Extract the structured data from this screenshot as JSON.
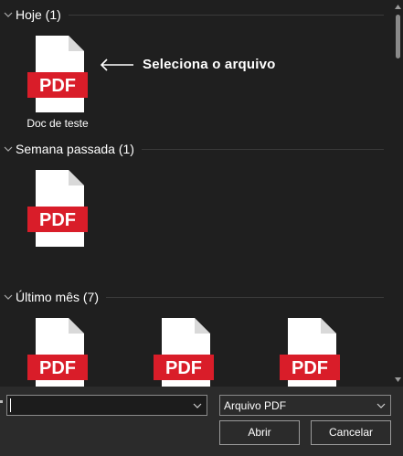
{
  "groups": [
    {
      "label": "Hoje (1)"
    },
    {
      "label": "Semana passada (1)"
    },
    {
      "label": "Último mês (7)"
    }
  ],
  "files": {
    "today": {
      "name": "Doc de teste",
      "badge": "PDF"
    },
    "last_week": {
      "badge": "PDF"
    },
    "last_month": [
      {
        "badge": "PDF"
      },
      {
        "badge": "PDF"
      },
      {
        "badge": "PDF"
      }
    ]
  },
  "annotation": {
    "text": "Seleciona o arquivo"
  },
  "bottom": {
    "filename_value": "",
    "filetype_selected": "Arquivo PDF",
    "open_label": "Abrir",
    "cancel_label": "Cancelar"
  },
  "colors": {
    "background": "#1f1f1f",
    "pdf_red": "#d91d29",
    "page_white": "#ffffff"
  },
  "icons": [
    "chevron-down-icon",
    "pdf-file-icon",
    "arrow-left-icon",
    "scroll-up-icon",
    "scroll-down-icon"
  ]
}
